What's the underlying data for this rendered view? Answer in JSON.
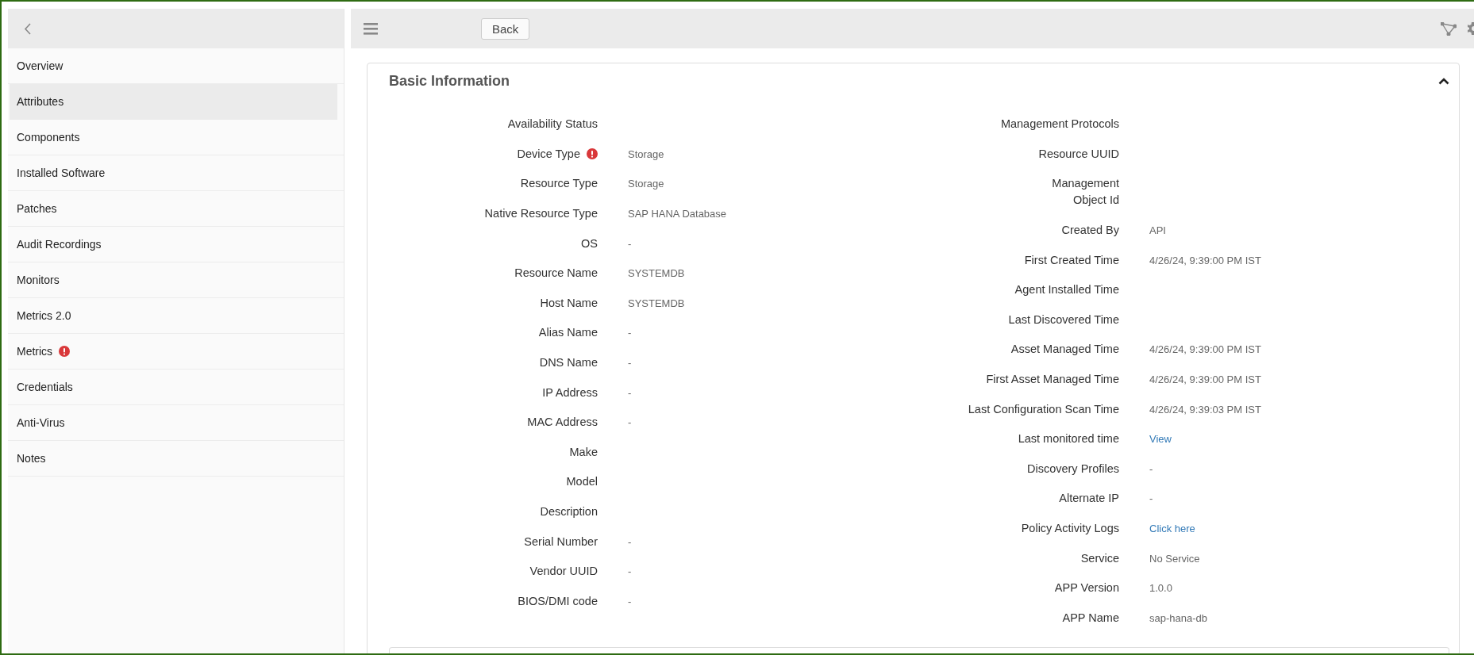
{
  "sidebar": {
    "items": [
      {
        "label": "Overview",
        "selected": false,
        "alert": false
      },
      {
        "label": "Attributes",
        "selected": true,
        "alert": false
      },
      {
        "label": "Components",
        "selected": false,
        "alert": false
      },
      {
        "label": "Installed Software",
        "selected": false,
        "alert": false
      },
      {
        "label": "Patches",
        "selected": false,
        "alert": false
      },
      {
        "label": "Audit Recordings",
        "selected": false,
        "alert": false
      },
      {
        "label": "Monitors",
        "selected": false,
        "alert": false
      },
      {
        "label": "Metrics 2.0",
        "selected": false,
        "alert": false
      },
      {
        "label": "Metrics",
        "selected": false,
        "alert": true
      },
      {
        "label": "Credentials",
        "selected": false,
        "alert": false
      },
      {
        "label": "Anti-Virus",
        "selected": false,
        "alert": false
      },
      {
        "label": "Notes",
        "selected": false,
        "alert": false
      }
    ]
  },
  "toolbar": {
    "back_button": "Back"
  },
  "card": {
    "title": "Basic Information",
    "expanded": true,
    "left_fields": [
      {
        "label": "Availability Status",
        "kind": "text",
        "alert": false
      },
      {
        "label": "Device Type",
        "value": "Storage",
        "kind": "text",
        "alert": true
      },
      {
        "label": "Resource Type",
        "value": "Storage",
        "kind": "text",
        "alert": false
      },
      {
        "label": "Native Resource Type",
        "value": "SAP HANA Database",
        "kind": "text",
        "alert": false
      },
      {
        "label": "OS",
        "value": "-",
        "kind": "text",
        "alert": false
      },
      {
        "label": "Resource Name",
        "value": "SYSTEMDB",
        "kind": "text",
        "alert": false
      },
      {
        "label": "Host Name",
        "value": "SYSTEMDB",
        "kind": "text",
        "alert": false
      },
      {
        "label": "Alias Name",
        "value": "-",
        "kind": "text",
        "alert": false
      },
      {
        "label": "DNS Name",
        "value": "-",
        "kind": "text",
        "alert": false
      },
      {
        "label": "IP Address",
        "value": "-",
        "kind": "text",
        "alert": false
      },
      {
        "label": "MAC Address",
        "value": "-",
        "kind": "text",
        "alert": false
      },
      {
        "label": "Make",
        "kind": "text",
        "alert": false
      },
      {
        "label": "Model",
        "kind": "text",
        "alert": false
      },
      {
        "label": "Description",
        "kind": "text",
        "alert": false
      },
      {
        "label": "Serial Number",
        "value": "-",
        "kind": "text",
        "alert": false
      },
      {
        "label": "Vendor UUID",
        "value": "-",
        "kind": "text",
        "alert": false
      },
      {
        "label": "BIOS/DMI code",
        "value": "-",
        "kind": "text",
        "alert": false
      }
    ],
    "right_fields": [
      {
        "label": "Management Protocols",
        "kind": "text",
        "alert": false
      },
      {
        "label": "Resource UUID",
        "kind": "text",
        "alert": false
      },
      {
        "label": "Management Object Id",
        "kind": "text",
        "alert": false
      },
      {
        "label": "Created By",
        "value": "API",
        "kind": "text",
        "alert": false
      },
      {
        "label": "First Created Time",
        "value": "4/26/24, 9:39:00 PM IST",
        "kind": "text",
        "alert": false
      },
      {
        "label": "Agent Installed Time",
        "kind": "text",
        "alert": false
      },
      {
        "label": "Last Discovered Time",
        "kind": "text",
        "alert": false
      },
      {
        "label": "Asset Managed Time",
        "value": "4/26/24, 9:39:00 PM IST",
        "kind": "text",
        "alert": false
      },
      {
        "label": "First Asset Managed Time",
        "value": "4/26/24, 9:39:00 PM IST",
        "kind": "text",
        "alert": false
      },
      {
        "label": "Last Configuration Scan Time",
        "value": "4/26/24, 9:39:03 PM IST",
        "kind": "text",
        "alert": false
      },
      {
        "label": "Last monitored time",
        "value": "View",
        "kind": "link",
        "alert": false
      },
      {
        "label": "Discovery Profiles",
        "value": "-",
        "kind": "text",
        "alert": false
      },
      {
        "label": "Alternate IP",
        "value": "-",
        "kind": "text",
        "alert": false
      },
      {
        "label": "Policy Activity Logs",
        "value": "Click here",
        "kind": "link",
        "alert": false
      },
      {
        "label": "Service",
        "value": "No Service",
        "kind": "text",
        "alert": false
      },
      {
        "label": "APP Version",
        "value": "1.0.0",
        "kind": "text",
        "alert": false
      },
      {
        "label": "APP Name",
        "value": "sap-hana-db",
        "kind": "text",
        "alert": false
      }
    ]
  }
}
